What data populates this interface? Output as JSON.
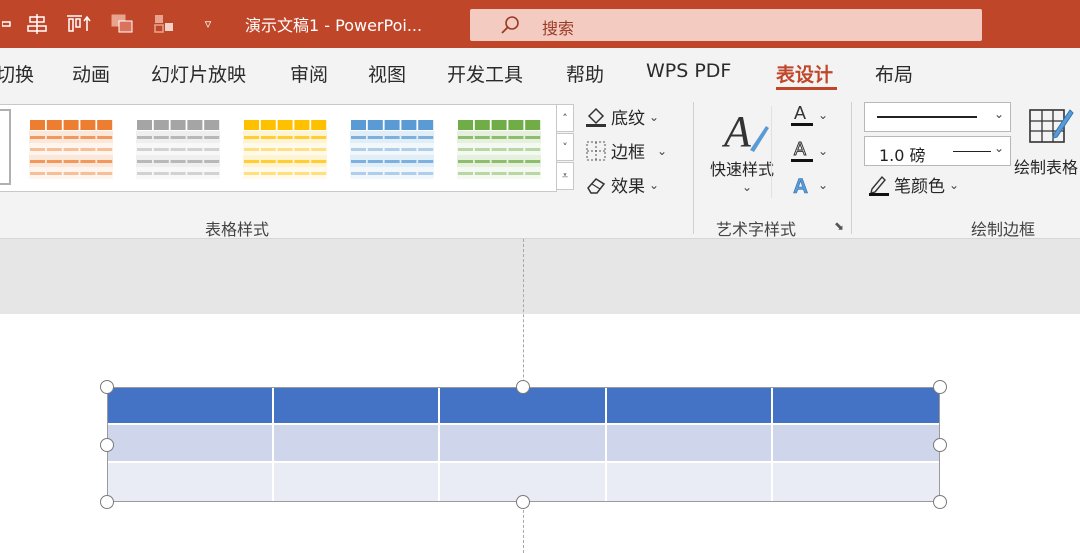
{
  "window": {
    "title": "演示文稿1 - PowerPoi...",
    "search_placeholder": "搜索",
    "accent": "#c0462a"
  },
  "quick_access": [
    "layout-icon",
    "align-icon",
    "distribute-icon",
    "arrange-icon",
    "group-icon",
    "customize-dropdown-icon"
  ],
  "tabs": [
    {
      "label": "切换",
      "active": false
    },
    {
      "label": "动画",
      "active": false
    },
    {
      "label": "幻灯片放映",
      "active": false
    },
    {
      "label": "审阅",
      "active": false
    },
    {
      "label": "视图",
      "active": false
    },
    {
      "label": "开发工具",
      "active": false
    },
    {
      "label": "帮助",
      "active": false
    },
    {
      "label": "WPS PDF",
      "active": false
    },
    {
      "label": "表设计",
      "active": true
    },
    {
      "label": "布局",
      "active": false
    }
  ],
  "ribbon": {
    "table_styles": {
      "group_label": "表格样式",
      "swatch_colors": [
        "#4472c4",
        "#ed7d31",
        "#a5a5a5",
        "#ffc000",
        "#5b9bd5",
        "#70ad47"
      ],
      "shading_label": "底纹",
      "borders_label": "边框",
      "effects_label": "效果"
    },
    "wordart": {
      "group_label": "艺术字样式",
      "quick_styles_label": "快速样式"
    },
    "draw_borders": {
      "group_label": "绘制边框",
      "pen_weight": "1.0 磅",
      "pen_color_label": "笔颜色",
      "draw_table_label": "绘制表格"
    }
  },
  "table": {
    "columns": 5,
    "header_color": "#4472c4",
    "band1_color": "#cfd5ea",
    "band2_color": "#e9ebf5"
  }
}
